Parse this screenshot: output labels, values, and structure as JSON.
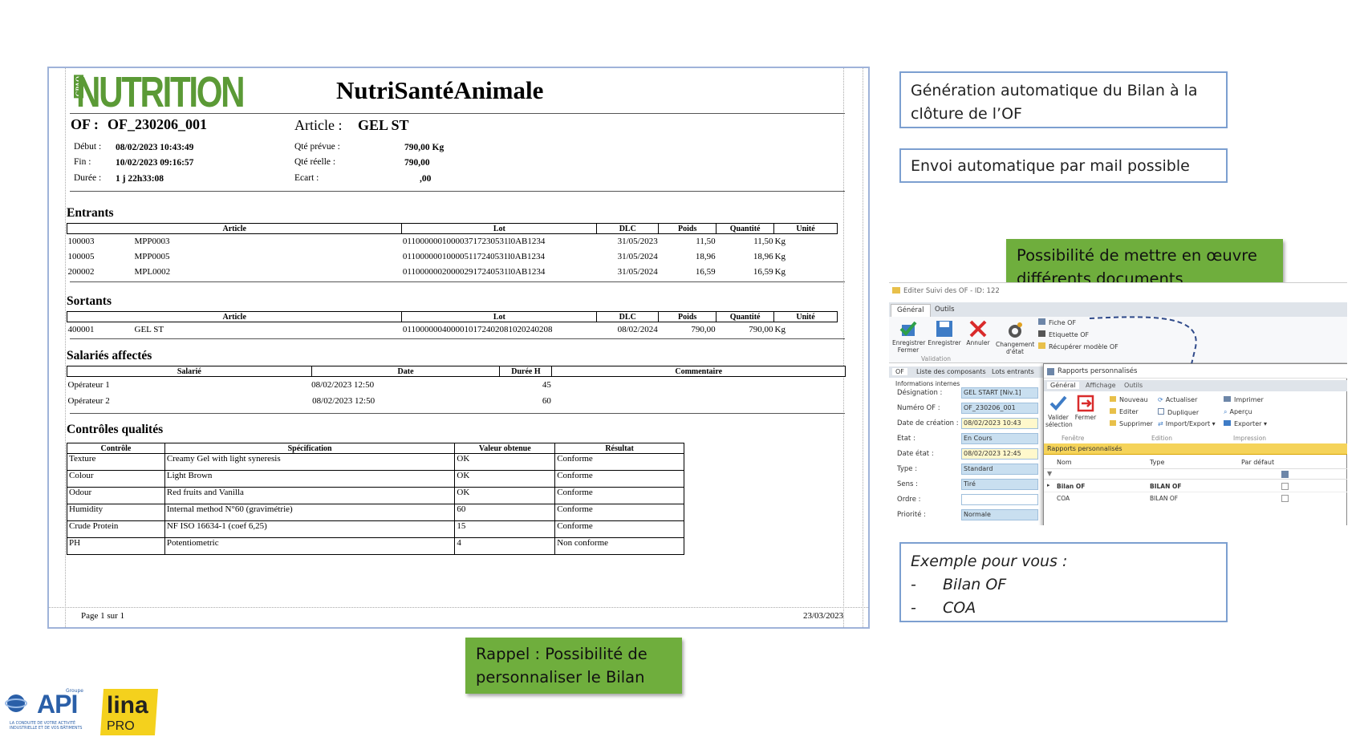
{
  "report": {
    "brand": "NUTRITION",
    "brand_tag": "GPAO",
    "title": "NutriSantéAnimale",
    "of_label": "OF :",
    "of_value": "OF_230206_001",
    "article_label": "Article :",
    "article_value": "GEL ST",
    "info": {
      "debut_label": "Début :",
      "debut_value": "08/02/2023 10:43:49",
      "fin_label": "Fin :",
      "fin_value": "10/02/2023 09:16:57",
      "duree_label": "Durée :",
      "duree_value": "1 j 22h33:08",
      "qte_prevue_label": "Qté prévue :",
      "qte_prevue_value": "790,00 Kg",
      "qte_reelle_label": "Qté réelle :",
      "qte_reelle_value": "790,00",
      "ecart_label": "Ecart :",
      "ecart_value": ",00"
    },
    "entrants": {
      "heading": "Entrants",
      "columns": [
        "Article",
        "Lot",
        "DLC",
        "Poids",
        "Quantité",
        "Unité"
      ],
      "rows": [
        [
          "100003",
          "MPP0003",
          "011000000100003717230531l0AB1234",
          "31/05/2023",
          "11,50",
          "11,50",
          "Kg"
        ],
        [
          "100005",
          "MPP0005",
          "011000000100005117240531l0AB1234",
          "31/05/2024",
          "18,96",
          "18,96",
          "Kg"
        ],
        [
          "200002",
          "MPL0002",
          "011000000200002917240531l0AB1234",
          "31/05/2024",
          "16,59",
          "16,59",
          "Kg"
        ]
      ]
    },
    "sortants": {
      "heading": "Sortants",
      "columns": [
        "Article",
        "Lot",
        "DLC",
        "Poids",
        "Quantité",
        "Unité"
      ],
      "rows": [
        [
          "400001",
          "GEL ST",
          "0110000004000010172402081020240208",
          "08/02/2024",
          "790,00",
          "790,00",
          "Kg"
        ]
      ]
    },
    "salaries": {
      "heading": "Salariés affectés",
      "columns": [
        "Salarié",
        "Date",
        "Durée H",
        "Commentaire"
      ],
      "rows": [
        [
          "Opérateur 1",
          "08/02/2023 12:50",
          "45",
          ""
        ],
        [
          "Opérateur 2",
          "08/02/2023 12:50",
          "60",
          ""
        ]
      ]
    },
    "controles": {
      "heading": "Contrôles qualités",
      "columns": [
        "Contrôle",
        "Spécification",
        "Valeur obtenue",
        "Résultat"
      ],
      "rows": [
        [
          "Texture",
          "Creamy Gel with light syneresis",
          "OK",
          "Conforme"
        ],
        [
          "Colour",
          "Light Brown",
          "OK",
          "Conforme"
        ],
        [
          "Odour",
          "Red fruits and Vanilla",
          "OK",
          "Conforme"
        ],
        [
          "Humidity",
          "Internal method N°60 (gravimétrie)",
          "60",
          "Conforme"
        ],
        [
          "Crude Protein",
          "NF ISO 16634-1 (coef 6,25)",
          "15",
          "Conforme"
        ],
        [
          "PH",
          "Potentiometric",
          "4",
          "Non conforme"
        ]
      ]
    },
    "footer_page": "Page 1 sur 1",
    "footer_date": "23/03/2023"
  },
  "callouts": {
    "generation": "Génération automatique du Bilan à la clôture de l’OF",
    "envoi": "Envoi automatique par mail possible",
    "documents": "Possibilité de mettre en œuvre différents documents",
    "rappel": "Rappel : Possibilité de personnaliser le Bilan",
    "exemple_title": "Exemple pour vous :",
    "exemple_items": [
      "Bilan OF",
      "COA"
    ]
  },
  "logos": {
    "api_group": "Groupe",
    "api": "API",
    "api_tagline": "LA CONDUITE DE VOTRE ACTIVITÉ INDUSTRIELLE ET DE VOS BÂTIMENTS",
    "lina": "lina",
    "pro": "PRO"
  },
  "app": {
    "window_title": "Editer Suivi des OF - ID: 122",
    "tabs": [
      "Général",
      "Outils"
    ],
    "buttons": {
      "save_close": "Enregistrer Fermer",
      "save": "Enregistrer",
      "cancel": "Annuler",
      "change_state": "Changement d'état",
      "validation_group": "Validation"
    },
    "menu_items": [
      "Fiche OF",
      "Etiquette OF",
      "Récupérer modèle OF"
    ],
    "sub_tabs": [
      "OF",
      "Liste des composants",
      "Lots entrants"
    ],
    "info_group": "Informations internes",
    "fields": [
      {
        "label": "Désignation :",
        "value": "GEL START [Niv.1]"
      },
      {
        "label": "Numéro OF :",
        "value": "OF_230206_001"
      },
      {
        "label": "Date de création :",
        "value": "08/02/2023 10:43"
      },
      {
        "label": "Etat :",
        "value": "En Cours"
      },
      {
        "label": "Date état :",
        "value": "08/02/2023 12:45"
      },
      {
        "label": "Type :",
        "value": "Standard"
      },
      {
        "label": "Sens :",
        "value": "Tiré"
      },
      {
        "label": "Ordre :",
        "value": ""
      },
      {
        "label": "Priorité :",
        "value": "Normale"
      }
    ],
    "popup": {
      "title": "Rapports personnalisés",
      "tabs": [
        "Général",
        "Affichage",
        "Outils"
      ],
      "validate": "Valider sélection",
      "close": "Fermer",
      "fenetre_group": "Fenêtre",
      "edition_actions": [
        "Nouveau",
        "Editer",
        "Supprimer",
        "Actualiser",
        "Dupliquer",
        "Import/Export"
      ],
      "edition_group": "Edition",
      "print_actions": [
        "Imprimer",
        "Aperçu",
        "Exporter"
      ],
      "impression_group": "Impression",
      "grid_title": "Rapports personnalisés",
      "grid_columns": [
        "Nom",
        "Type",
        "Par défaut"
      ],
      "grid_rows": [
        {
          "nom": "Bilan OF",
          "type": "BILAN OF"
        },
        {
          "nom": "COA",
          "type": "BILAN OF"
        }
      ]
    }
  }
}
